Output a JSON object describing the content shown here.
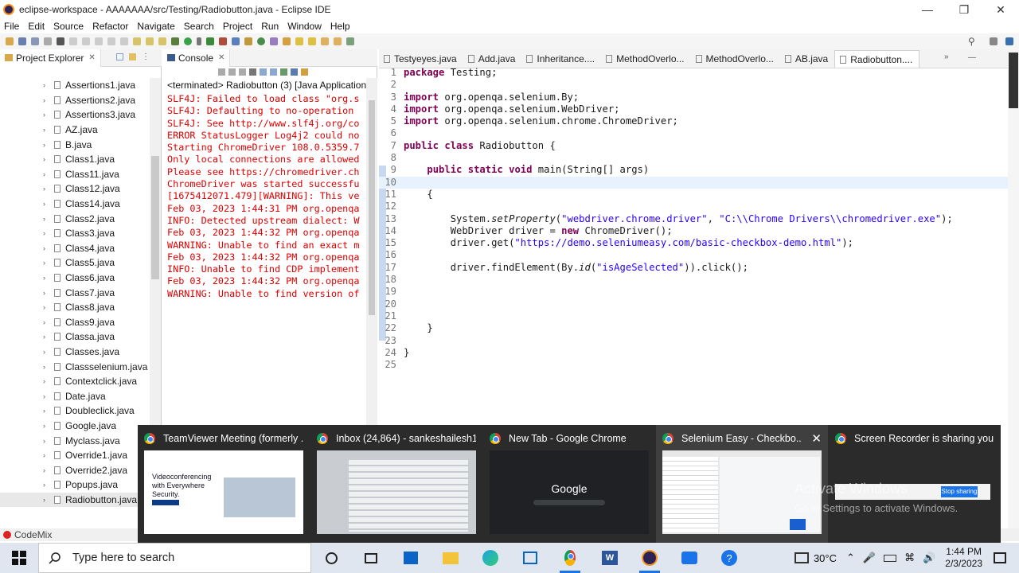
{
  "window": {
    "title": "eclipse-workspace - AAAAAAA/src/Testing/Radiobutton.java - Eclipse IDE"
  },
  "menu": [
    "File",
    "Edit",
    "Source",
    "Refactor",
    "Navigate",
    "Search",
    "Project",
    "Run",
    "Window",
    "Help"
  ],
  "project_explorer": {
    "title": "Project Explorer",
    "items": [
      "Assertions1.java",
      "Assertions2.java",
      "Assertions3.java",
      "AZ.java",
      "B.java",
      "Class1.java",
      "Class11.java",
      "Class12.java",
      "Class14.java",
      "Class2.java",
      "Class3.java",
      "Class4.java",
      "Class5.java",
      "Class6.java",
      "Class7.java",
      "Class8.java",
      "Class9.java",
      "Classa.java",
      "Classes.java",
      "Classselenium.java",
      "Contextclick.java",
      "Date.java",
      "Doubleclick.java",
      "Google.java",
      "Myclass.java",
      "Override1.java",
      "Override2.java",
      "Popups.java",
      "Radiobutton.java"
    ],
    "selected": "Radiobutton.java"
  },
  "console": {
    "title": "Console",
    "status": "<terminated> Radiobutton (3) [Java Application] C:",
    "lines": [
      "SLF4J: Failed to load class \"org.s",
      "SLF4J: Defaulting to no-operation",
      "SLF4J: See http://www.slf4j.org/co",
      "ERROR StatusLogger Log4j2 could no",
      "Starting ChromeDriver 108.0.5359.7",
      "Only local connections are allowed",
      "Please see https://chromedriver.ch",
      "ChromeDriver was started successfu",
      "[1675412071.479][WARNING]: This ve",
      "Feb 03, 2023 1:44:31 PM org.openqa",
      "INFO: Detected upstream dialect: W",
      "Feb 03, 2023 1:44:32 PM org.openqa",
      "WARNING: Unable to find an exact m",
      "Feb 03, 2023 1:44:32 PM org.openqa",
      "INFO: Unable to find CDP implement",
      "Feb 03, 2023 1:44:32 PM org.openqa",
      "WARNING: Unable to find version of"
    ]
  },
  "editor": {
    "tabs": [
      "Testyeyes.java",
      "Add.java",
      "Inheritance....",
      "MethodOverlo...",
      "MethodOverlo...",
      "AB.java",
      "Radiobutton...."
    ],
    "active_tab": "Radiobutton....",
    "line_numbers": [
      "1",
      "2",
      "3",
      "4",
      "5",
      "6",
      "7",
      "8",
      "9",
      "10",
      "11",
      "12",
      "13",
      "14",
      "15",
      "16",
      "17",
      "18",
      "19",
      "20",
      "21",
      "22",
      "23",
      "24",
      "25"
    ],
    "code": {
      "l1_kw": "package",
      "l1_rest": " Testing;",
      "l3_kw": "import",
      "l3_rest": " org.openqa.selenium.By;",
      "l4_kw": "import",
      "l4_rest": " org.openqa.selenium.WebDriver;",
      "l5_kw": "import",
      "l5_rest": " org.openqa.selenium.chrome.ChromeDriver;",
      "l7_kw1": "public",
      "l7_kw2": "class",
      "l7_rest": " Radiobutton {",
      "l9_kw1": "public",
      "l9_kw2": "static",
      "l9_kw3": "void",
      "l9_rest": " main(String[] args)",
      "l11": "{",
      "l13_a": "System.",
      "l13_m": "setProperty",
      "l13_b": "(",
      "l13_s1": "\"webdriver.chrome.driver\"",
      "l13_c": ", ",
      "l13_s2": "\"C:\\\\Chrome Drivers\\\\chromedriver.exe\"",
      "l13_d": ");",
      "l14_a": "WebDriver driver = ",
      "l14_kw": "new",
      "l14_b": " ChromeDriver();",
      "l15_a": "driver.get(",
      "l15_s": "\"https://demo.seleniumeasy.com/basic-checkbox-demo.html\"",
      "l15_b": ");",
      "l17_a": "driver.findElement(By.",
      "l17_m": "id",
      "l17_b": "(",
      "l17_s": "\"isAgeSelected\"",
      "l17_c": ")).click();",
      "l22": "}",
      "l24": "}"
    }
  },
  "statusbar": {
    "label": "CodeMix"
  },
  "task_previews": [
    {
      "title": "TeamViewer Meeting (formerly ...",
      "thumb_text": "Videoconferencing with Everywhere Security."
    },
    {
      "title": "Inbox (24,864) - sankeshailesh1...",
      "thumb_text": ""
    },
    {
      "title": "New Tab - Google Chrome",
      "thumb_text": "Google"
    },
    {
      "title": "Selenium Easy - Checkbo...",
      "thumb_text": ""
    },
    {
      "title": "Screen Recorder is sharing your...",
      "thumb_text": "Stop sharing"
    }
  ],
  "watermark": {
    "line1": "Activate Windows",
    "line2": "Go to Settings to activate Windows."
  },
  "taskbar": {
    "search_placeholder": "Type here to search",
    "temperature": "30°C",
    "time": "1:44 PM",
    "date": "2/3/2023"
  },
  "colors": {
    "keyword": "#7f0055",
    "string": "#2a00ff",
    "console_error": "#e00000",
    "taskbar": "#dfe6f0"
  }
}
